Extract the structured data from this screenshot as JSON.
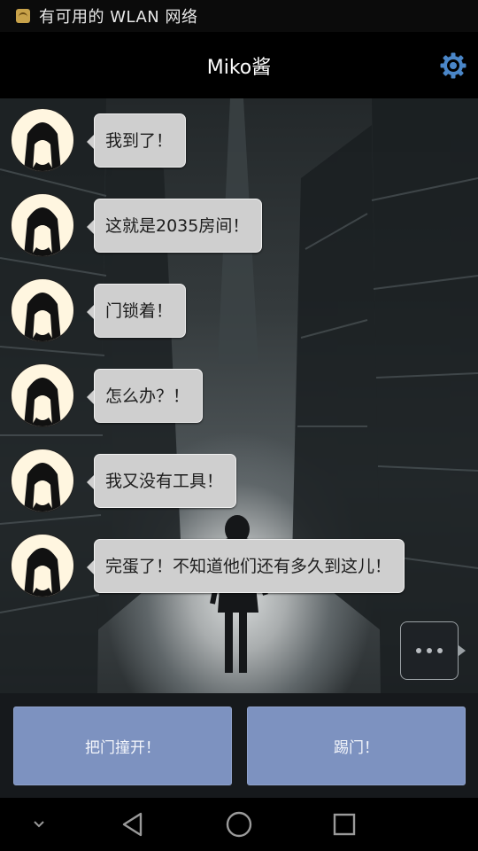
{
  "status_bar": {
    "text": "有可用的 WLAN 网络",
    "icon": "wifi-notification-icon"
  },
  "app_bar": {
    "title": "Miko酱",
    "settings_icon": "gear-icon",
    "accent": "#4a86c8"
  },
  "messages": [
    {
      "text": "我到了！"
    },
    {
      "text": "这就是2035房间！"
    },
    {
      "text": "门锁着！"
    },
    {
      "text": "怎么办？！"
    },
    {
      "text": "我又没有工具！"
    },
    {
      "text": "完蛋了！不知道他们还有多久到这儿！"
    }
  ],
  "typing_indicator": {
    "icon": "typing-dots-icon"
  },
  "choices": [
    {
      "label": "把门撞开！"
    },
    {
      "label": "踢门！"
    }
  ],
  "colors": {
    "choice_button": "#7d92c0",
    "bubble": "#cfcfcf",
    "avatar_bg": "#fff6e0"
  },
  "nav_bar": {
    "icons": [
      "chevron-down-icon",
      "back-triangle-icon",
      "home-circle-icon",
      "recents-square-icon"
    ]
  }
}
